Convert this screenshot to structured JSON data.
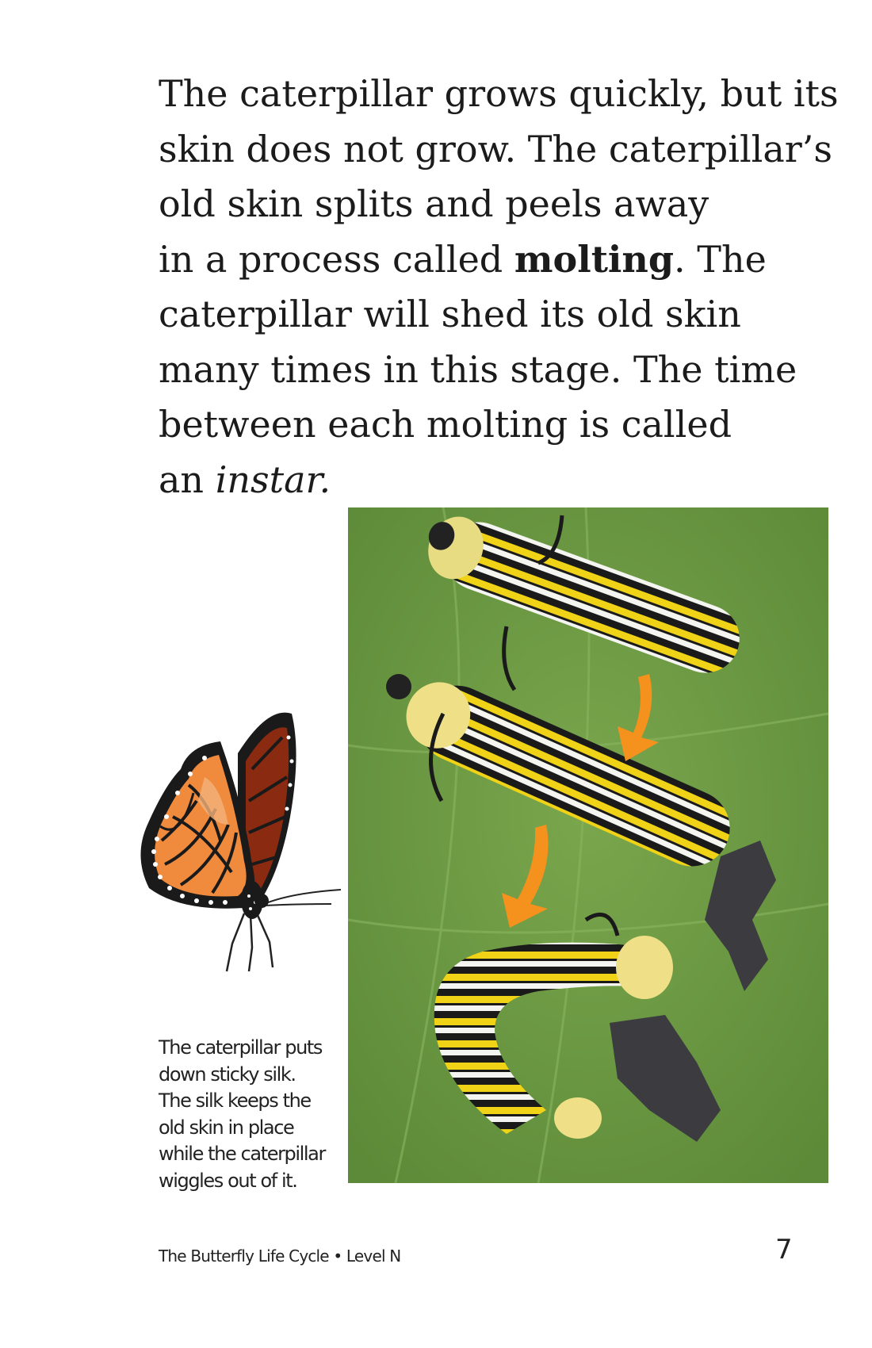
{
  "paragraph": {
    "l1": "The caterpillar grows quickly, but its",
    "l2": "skin does not grow. The caterpillar’s",
    "l3": "old skin splits and peels away",
    "l4_pre": "in a process called ",
    "l4_bold": "molting",
    "l4_post": ". The",
    "l5": "caterpillar will shed its old skin",
    "l6": "many times in this stage. The time",
    "l7": "between each molting is called",
    "l8_pre": "an ",
    "l8_italic": "instar."
  },
  "caption": {
    "lines": [
      "The caterpillar puts",
      "down sticky silk.",
      "The silk keeps the",
      "old skin in place",
      "while the caterpillar",
      "wiggles out of it."
    ]
  },
  "footer": {
    "title": "The Butterfly Life Cycle • Level N",
    "page_number": "7"
  },
  "images": {
    "butterfly_icon": "monarch-butterfly",
    "photo_icon": "caterpillars-molting-photo",
    "arrow_color": "#f5921e",
    "leaf_color": "#6e9a45"
  }
}
